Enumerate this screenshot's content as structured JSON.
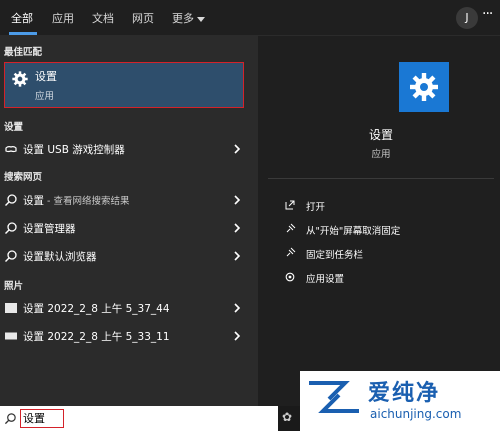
{
  "tabs": [
    {
      "label": "全部"
    },
    {
      "label": "应用"
    },
    {
      "label": "文档"
    },
    {
      "label": "网页"
    },
    {
      "label": "更多"
    }
  ],
  "header": {
    "avatar_letter": "J",
    "more_glyph": "···"
  },
  "best_match": {
    "section_label": "最佳匹配",
    "title": "设置",
    "subtitle": "应用"
  },
  "settings_section": {
    "label": "设置",
    "items": [
      {
        "label": "设置 USB 游戏控制器"
      }
    ]
  },
  "web_section": {
    "label": "搜索网页",
    "items": [
      {
        "label": "设置",
        "sub": " - 查看网络搜索结果"
      },
      {
        "label": "设置管理器"
      },
      {
        "label": "设置默认浏览器"
      }
    ]
  },
  "photos_section": {
    "label": "照片",
    "items": [
      {
        "label": "设置 2022_2_8 上午 5_37_44"
      },
      {
        "label": "设置 2022_2_8 上午 5_33_11"
      }
    ]
  },
  "detail": {
    "title": "设置",
    "subtitle": "应用",
    "actions": [
      {
        "label": "打开",
        "icon": "open-icon"
      },
      {
        "label": "从\"开始\"屏幕取消固定",
        "icon": "unpin-icon"
      },
      {
        "label": "固定到任务栏",
        "icon": "pin-icon"
      },
      {
        "label": "应用设置",
        "icon": "gear-icon"
      }
    ]
  },
  "search": {
    "value": "设置"
  },
  "watermark": {
    "text": "爱纯净",
    "url": "aichunjing.com"
  },
  "colors": {
    "accent": "#1a78d4",
    "highlight": "#2e4e6c",
    "callout": "#d4222a"
  }
}
